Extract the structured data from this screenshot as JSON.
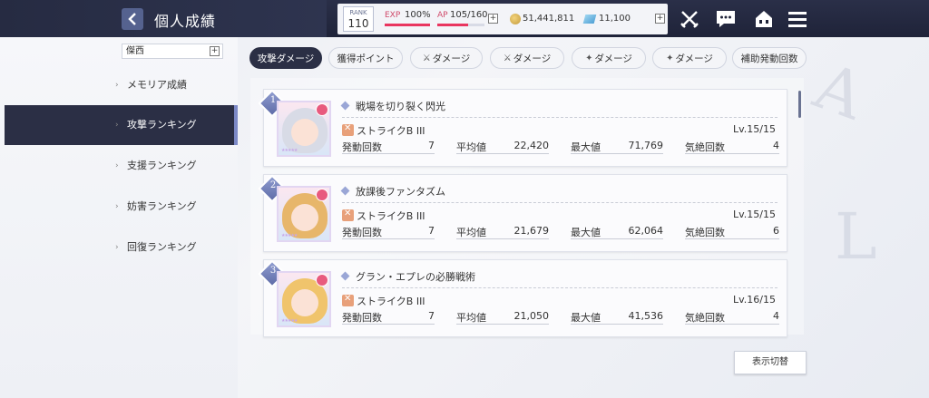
{
  "header": {
    "title": "個人成績",
    "rank_label": "RANK",
    "rank_value": "110",
    "exp_label": "EXP",
    "exp_value": "100%",
    "exp_progress": 1.0,
    "ap_label": "AP",
    "ap_value": "105/160",
    "ap_progress": 0.66,
    "plus": "+",
    "gold_value": "51,441,811",
    "gem_value": "11,100"
  },
  "sidebar": {
    "unit_name": "傑西",
    "unit_plus": "+",
    "items": [
      {
        "label": "メモリア成績"
      },
      {
        "label": "攻撃ランキング"
      },
      {
        "label": "支援ランキング"
      },
      {
        "label": "妨害ランキング"
      },
      {
        "label": "回復ランキング"
      }
    ],
    "chevron": "›"
  },
  "tabs": [
    {
      "label": "攻撃ダメージ"
    },
    {
      "label": "獲得ポイント"
    },
    {
      "label": "ダメージ"
    },
    {
      "label": "ダメージ"
    },
    {
      "label": "ダメージ"
    },
    {
      "label": "ダメージ"
    },
    {
      "label": "補助発動回数"
    }
  ],
  "cards": [
    {
      "rank": "1",
      "title": "戦場を切り裂く閃光",
      "skill": "ストライクB III",
      "level": "Lv.15/15",
      "stats": [
        {
          "label": "発動回数",
          "value": "7"
        },
        {
          "label": "平均値",
          "value": "22,420"
        },
        {
          "label": "最大値",
          "value": "71,769"
        },
        {
          "label": "気絶回数",
          "value": "4"
        }
      ]
    },
    {
      "rank": "2",
      "title": "放課後ファンタズム",
      "skill": "ストライクB III",
      "level": "Lv.15/15",
      "stats": [
        {
          "label": "発動回数",
          "value": "7"
        },
        {
          "label": "平均値",
          "value": "21,679"
        },
        {
          "label": "最大値",
          "value": "62,064"
        },
        {
          "label": "気絶回数",
          "value": "6"
        }
      ]
    },
    {
      "rank": "3",
      "title": "グラン・エプレの必勝戦術",
      "skill": "ストライクB III",
      "level": "Lv.16/15",
      "stats": [
        {
          "label": "発動回数",
          "value": "7"
        },
        {
          "label": "平均値",
          "value": "21,050"
        },
        {
          "label": "最大値",
          "value": "41,536"
        },
        {
          "label": "気絶回数",
          "value": "4"
        }
      ]
    }
  ],
  "footer": {
    "switch_label": "表示切替"
  },
  "colors": {
    "dark_navy": "#2b2f45",
    "accent_pink": "#e9355f",
    "accent_purple": "#7c89c6"
  }
}
